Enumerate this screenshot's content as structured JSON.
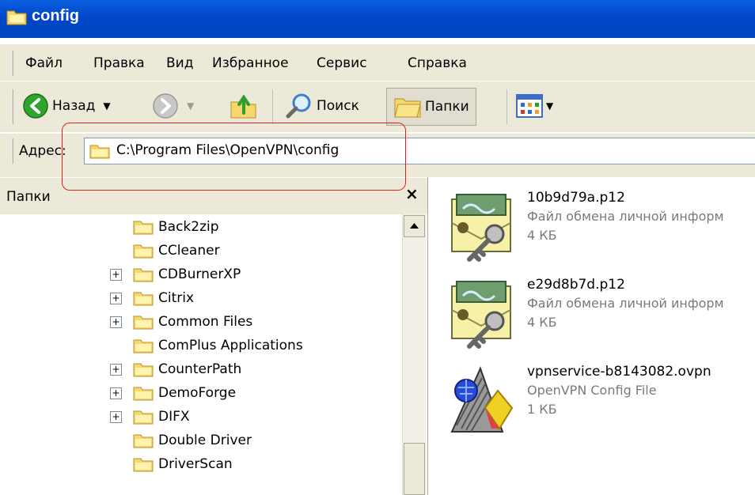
{
  "window": {
    "title": "config"
  },
  "menu": [
    "Файл",
    "Правка",
    "Вид",
    "Избранное",
    "Сервис",
    "Справка"
  ],
  "toolbar": {
    "back_label": "Назад",
    "search_label": "Поиск",
    "folders_label": "Папки"
  },
  "address": {
    "label": "Адрес:",
    "value": "C:\\Program Files\\OpenVPN\\config"
  },
  "folders_pane": {
    "title": "Папки",
    "close": "×",
    "items": [
      {
        "label": "Back2zip",
        "expandable": false
      },
      {
        "label": "CCleaner",
        "expandable": false
      },
      {
        "label": "CDBurnerXP",
        "expandable": true
      },
      {
        "label": "Citrix",
        "expandable": true
      },
      {
        "label": "Common Files",
        "expandable": true
      },
      {
        "label": "ComPlus Applications",
        "expandable": false
      },
      {
        "label": "CounterPath",
        "expandable": true
      },
      {
        "label": "DemoForge",
        "expandable": true
      },
      {
        "label": "DIFX",
        "expandable": true
      },
      {
        "label": "Double Driver",
        "expandable": false
      },
      {
        "label": "DriverScan",
        "expandable": false
      }
    ]
  },
  "files": [
    {
      "name": "10b9d79a.p12",
      "type": "Файл обмена личной информ",
      "size": "4 КБ",
      "icon": "certificate-icon"
    },
    {
      "name": "e29d8b7d.p12",
      "type": "Файл обмена личной информ",
      "size": "4 КБ",
      "icon": "certificate-icon"
    },
    {
      "name": "vpnservice-b8143082.ovpn",
      "type": "OpenVPN Config File",
      "size": "1 КБ",
      "icon": "openvpn-config-icon"
    }
  ],
  "colors": {
    "titlebar": "#0047c8",
    "chrome": "#ece9d8",
    "highlight": "#e02020"
  }
}
